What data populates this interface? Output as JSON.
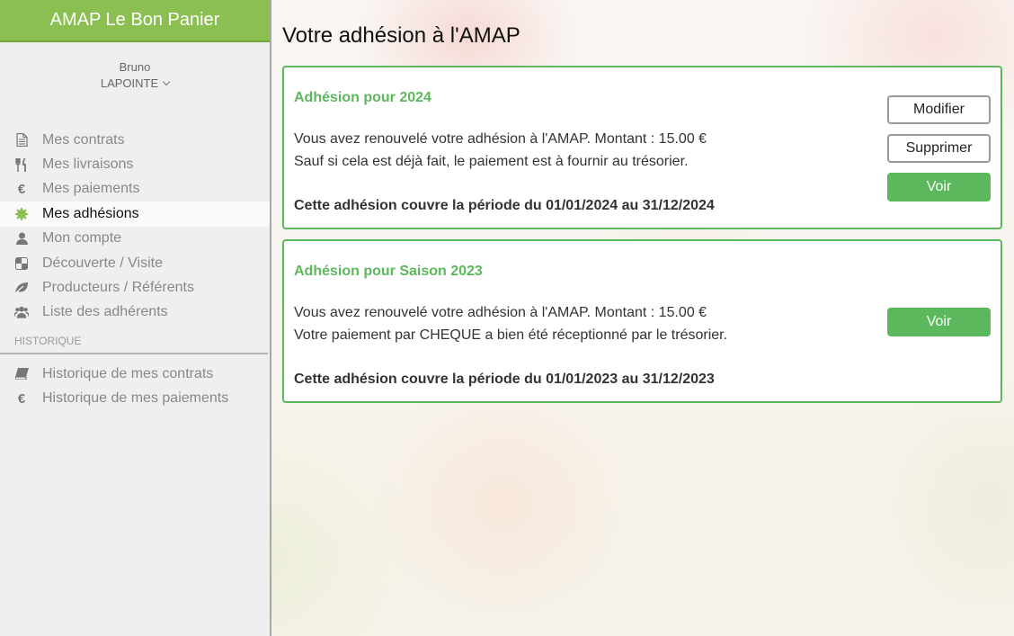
{
  "app": {
    "title": "AMAP Le Bon Panier",
    "accent": "#8cbf52",
    "card_accent": "#5cb85c"
  },
  "user": {
    "first_name": "Bruno",
    "last_name": "LAPOINTE"
  },
  "nav": {
    "items": [
      {
        "label": "Mes contrats",
        "icon": "file-icon"
      },
      {
        "label": "Mes livraisons",
        "icon": "cutlery-icon"
      },
      {
        "label": "Mes paiements",
        "icon": "euro-icon"
      },
      {
        "label": "Mes adhésions",
        "icon": "badge-icon",
        "active": true
      },
      {
        "label": "Mon compte",
        "icon": "user-icon"
      },
      {
        "label": "Découverte / Visite",
        "icon": "checkerboard-icon"
      },
      {
        "label": "Producteurs / Référents",
        "icon": "leaf-icon"
      },
      {
        "label": "Liste des adhérents",
        "icon": "users-icon"
      }
    ],
    "section_label": "HISTORIQUE",
    "history_items": [
      {
        "label": "Historique de mes contrats",
        "icon": "book-icon"
      },
      {
        "label": "Historique de mes paiements",
        "icon": "euro-icon"
      }
    ]
  },
  "main": {
    "title": "Votre adhésion à l'AMAP",
    "cards": [
      {
        "title": "Adhésion pour 2024",
        "line1": "Vous avez renouvelé votre adhésion à l'AMAP. Montant : 15.00 €",
        "line2": "Sauf si cela est déjà fait, le paiement est à fournir au trésorier.",
        "period": "Cette adhésion couvre la période du 01/01/2024 au 31/12/2024",
        "buttons": {
          "modify": "Modifier",
          "delete": "Supprimer",
          "view": "Voir"
        }
      },
      {
        "title": "Adhésion pour Saison 2023",
        "line1": "Vous avez renouvelé votre adhésion à l'AMAP. Montant : 15.00 €",
        "line2": "Votre paiement par CHEQUE a bien été réceptionné par le trésorier.",
        "period": "Cette adhésion couvre la période du 01/01/2023 au 31/12/2023",
        "buttons": {
          "view": "Voir"
        }
      }
    ]
  }
}
